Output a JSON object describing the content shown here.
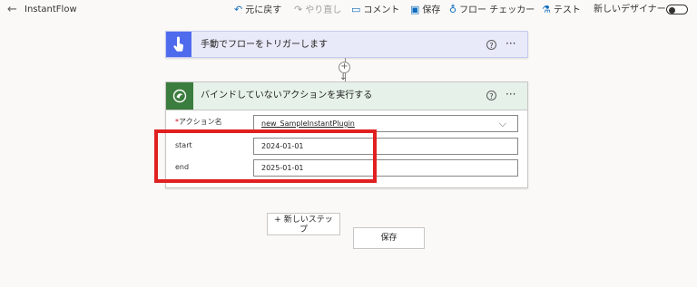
{
  "app": {
    "back_icon": "back-arrow-icon",
    "name": "InstantFlow"
  },
  "commands": {
    "undo": "元に戻す",
    "redo": "やり直し",
    "comment": "コメント",
    "save": "保存",
    "flow_checker": "フロー チェッカー",
    "test": "テスト",
    "new_designer": "新しいデザイナー"
  },
  "toggle": {
    "state": "off"
  },
  "trigger": {
    "title": "手動でフローをトリガーします",
    "help": "?",
    "more": "···",
    "color": "#4f6bed"
  },
  "insert": {
    "plus": "+",
    "arrow": "↓"
  },
  "action": {
    "title": "バインドしていないアクションを実行する",
    "help": "?",
    "more": "···",
    "color": "#3b7d3e",
    "fields": {
      "action_name_required": "*",
      "action_name_label": "アクション名",
      "action_name_value": "new_SampleInstantPlugin",
      "start_label": "start",
      "start_value": "2024-01-01",
      "end_label": "end",
      "end_value": "2025-01-01"
    }
  },
  "bottom": {
    "new_step_line1": "+ 新しいステッ",
    "new_step_line2": "プ",
    "save": "保存"
  },
  "highlight_color": "#e02020"
}
